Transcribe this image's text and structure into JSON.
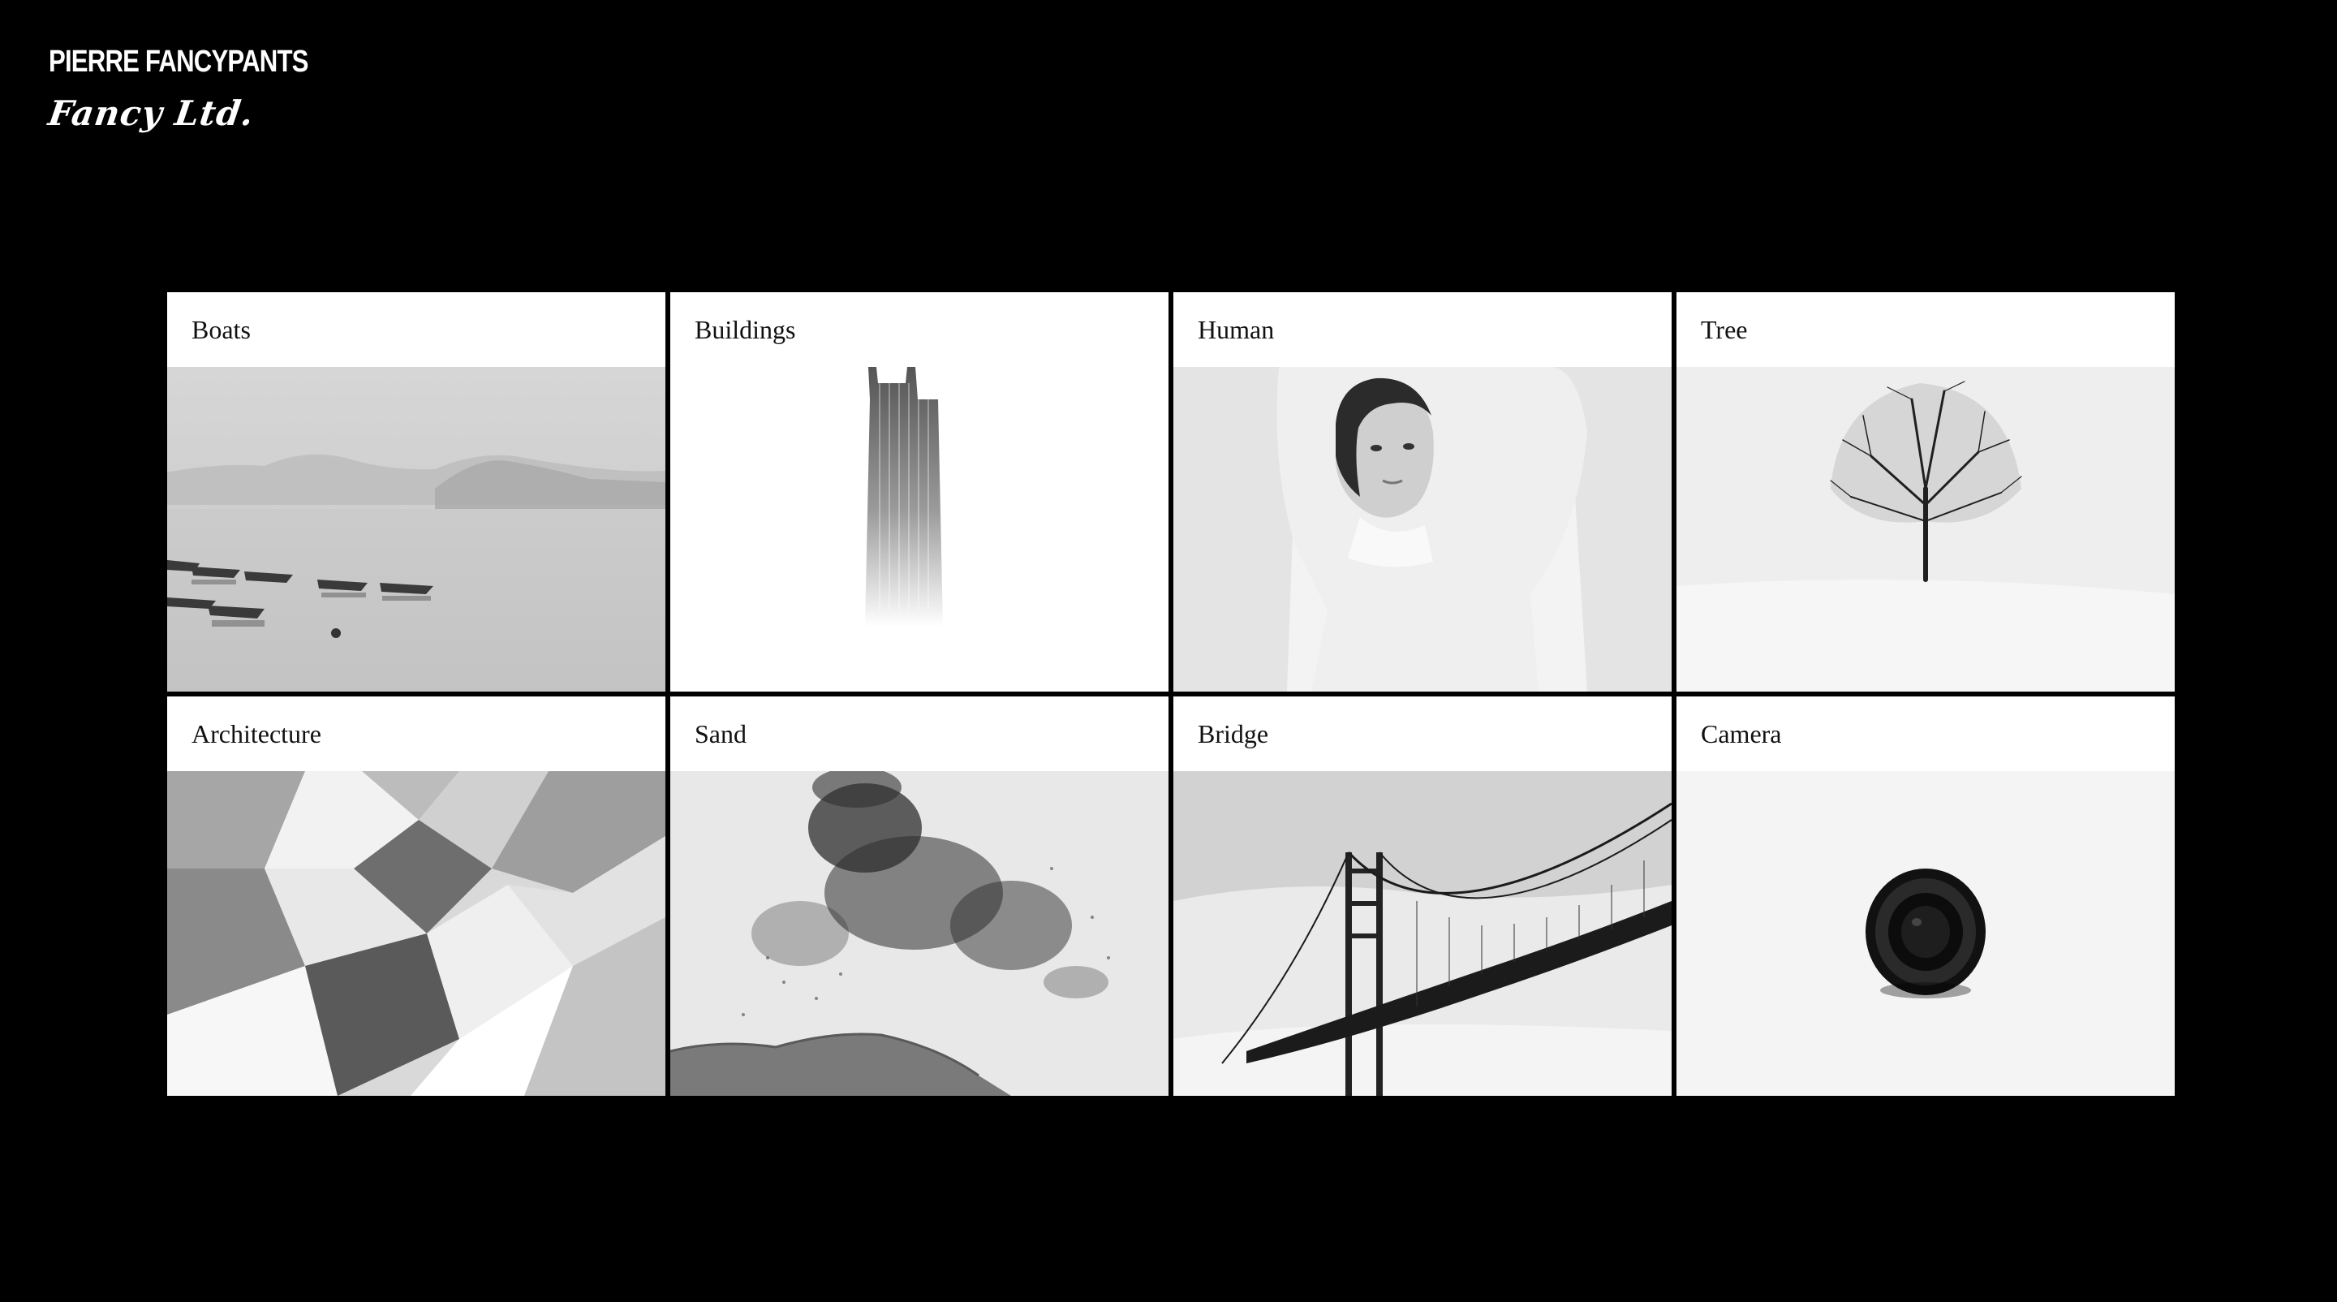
{
  "brand": {
    "name": "PIERRE FANCYPANTS",
    "logo_text": "Fancy Ltd."
  },
  "gallery": {
    "items": [
      {
        "label": "Boats",
        "photo": "misty-boats-on-lake"
      },
      {
        "label": "Buildings",
        "photo": "skyscraper-in-fog"
      },
      {
        "label": "Human",
        "photo": "woman-arms-raised-portrait"
      },
      {
        "label": "Tree",
        "photo": "lone-tree-in-snow"
      },
      {
        "label": "Architecture",
        "photo": "geometric-facade-panels"
      },
      {
        "label": "Sand",
        "photo": "sand-dust-burst"
      },
      {
        "label": "Bridge",
        "photo": "golden-gate-bridge-fog"
      },
      {
        "label": "Camera",
        "photo": "camera-lens-top-view"
      }
    ]
  },
  "colors": {
    "background": "#000000",
    "card": "#ffffff",
    "text": "#111111"
  }
}
